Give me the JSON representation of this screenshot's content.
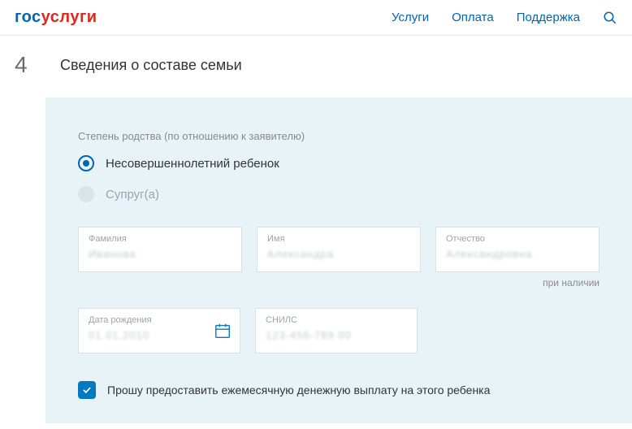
{
  "header": {
    "logo_part1": "гос",
    "logo_part2": "услуги",
    "nav": [
      "Услуги",
      "Оплата",
      "Поддержка"
    ]
  },
  "step": {
    "number": "4",
    "title": "Сведения о составе семьи"
  },
  "form": {
    "relation_label": "Степень родства (по отношению к заявителю)",
    "options": [
      {
        "label": "Несовершеннолетний ребенок",
        "selected": true
      },
      {
        "label": "Супруг(а)",
        "selected": false
      }
    ],
    "fields": {
      "lastname": {
        "label": "Фамилия",
        "value": "Иванова"
      },
      "firstname": {
        "label": "Имя",
        "value": "Александра"
      },
      "patronymic": {
        "label": "Отчество",
        "value": "Александровна"
      },
      "patronymic_hint": "при наличии",
      "birthdate": {
        "label": "Дата рождения",
        "value": "01.01.2010"
      },
      "snils": {
        "label": "СНИЛС",
        "value": "123-456-789 00"
      }
    },
    "checkbox_label": "Прошу предоставить ежемесячную денежную выплату на этого ребенка",
    "checkbox_checked": true
  }
}
